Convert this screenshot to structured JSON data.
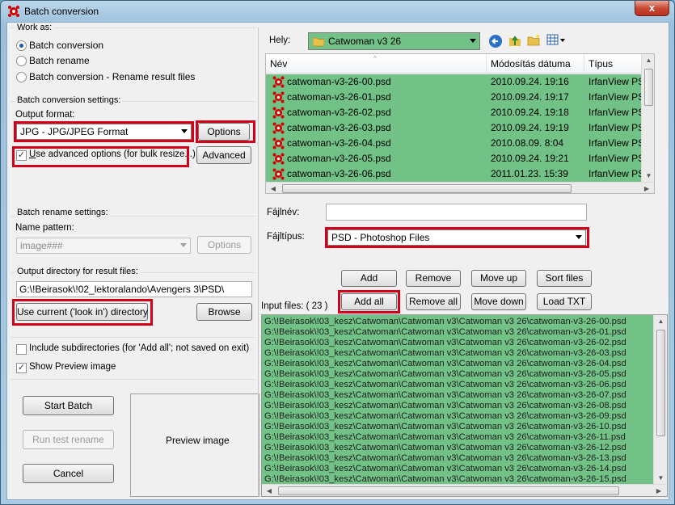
{
  "window": {
    "title": "Batch conversion",
    "close_glyph": "x"
  },
  "work_as": {
    "group_title": "Work as:",
    "options": [
      {
        "label": "Batch conversion",
        "checked": true
      },
      {
        "label": "Batch rename",
        "checked": false
      },
      {
        "label": "Batch conversion - Rename result files",
        "checked": false
      }
    ]
  },
  "conversion": {
    "group_title": "Batch conversion settings:",
    "output_format_label": "Output format:",
    "output_format_value": "JPG - JPG/JPEG Format",
    "options_button": "Options",
    "advanced_checkbox": "Use advanced options (for bulk resize...)",
    "advanced_checked": true,
    "advanced_button": "Advanced"
  },
  "rename": {
    "group_title": "Batch rename settings:",
    "name_pattern_label": "Name pattern:",
    "name_pattern_value": "image###",
    "options_button": "Options"
  },
  "output_dir": {
    "group_title": "Output directory for result files:",
    "path": "G:\\!Beirasok\\!02_lektoralando\\Avengers 3\\PSD\\",
    "use_current_button": "Use current ('look in') directory",
    "browse_button": "Browse"
  },
  "checks": {
    "include_subdirs": "Include subdirectories (for 'Add all'; not saved on exit)",
    "include_subdirs_checked": false,
    "show_preview": "Show Preview image",
    "show_preview_checked": true
  },
  "actions": {
    "start": "Start Batch",
    "run_test": "Run test rename",
    "cancel": "Cancel",
    "preview_label": "Preview image"
  },
  "browser": {
    "look_in_label": "Hely:",
    "look_in_value": "Catwoman v3 26",
    "columns": [
      "Név",
      "Módosítás dátuma",
      "Típus"
    ],
    "files": [
      {
        "name": "catwoman-v3-26-00.psd",
        "date": "2010.09.24. 19:16",
        "type": "IrfanView PSD F"
      },
      {
        "name": "catwoman-v3-26-01.psd",
        "date": "2010.09.24. 19:17",
        "type": "IrfanView PSD F"
      },
      {
        "name": "catwoman-v3-26-02.psd",
        "date": "2010.09.24. 19:18",
        "type": "IrfanView PSD F"
      },
      {
        "name": "catwoman-v3-26-03.psd",
        "date": "2010.09.24. 19:19",
        "type": "IrfanView PSD F"
      },
      {
        "name": "catwoman-v3-26-04.psd",
        "date": "2010.08.09. 8:04",
        "type": "IrfanView PSD F"
      },
      {
        "name": "catwoman-v3-26-05.psd",
        "date": "2010.09.24. 19:21",
        "type": "IrfanView PSD F"
      },
      {
        "name": "catwoman-v3-26-06.psd",
        "date": "2011.01.23. 15:39",
        "type": "IrfanView PSD F"
      }
    ],
    "filename_label": "Fájlnév:",
    "filename_value": "",
    "filetype_label": "Fájltípus:",
    "filetype_value": "PSD - Photoshop Files"
  },
  "list_buttons": {
    "add": "Add",
    "remove": "Remove",
    "move_up": "Move up",
    "sort_files": "Sort files",
    "add_all": "Add all",
    "remove_all": "Remove all",
    "move_down": "Move down",
    "load_txt": "Load TXT"
  },
  "input_files": {
    "label": "Input files: ( 23 )",
    "items": [
      "G:\\!Beirasok\\!03_kesz\\Catwoman\\Catwoman v3\\Catwoman v3 26\\catwoman-v3-26-00.psd",
      "G:\\!Beirasok\\!03_kesz\\Catwoman\\Catwoman v3\\Catwoman v3 26\\catwoman-v3-26-01.psd",
      "G:\\!Beirasok\\!03_kesz\\Catwoman\\Catwoman v3\\Catwoman v3 26\\catwoman-v3-26-02.psd",
      "G:\\!Beirasok\\!03_kesz\\Catwoman\\Catwoman v3\\Catwoman v3 26\\catwoman-v3-26-03.psd",
      "G:\\!Beirasok\\!03_kesz\\Catwoman\\Catwoman v3\\Catwoman v3 26\\catwoman-v3-26-04.psd",
      "G:\\!Beirasok\\!03_kesz\\Catwoman\\Catwoman v3\\Catwoman v3 26\\catwoman-v3-26-05.psd",
      "G:\\!Beirasok\\!03_kesz\\Catwoman\\Catwoman v3\\Catwoman v3 26\\catwoman-v3-26-06.psd",
      "G:\\!Beirasok\\!03_kesz\\Catwoman\\Catwoman v3\\Catwoman v3 26\\catwoman-v3-26-07.psd",
      "G:\\!Beirasok\\!03_kesz\\Catwoman\\Catwoman v3\\Catwoman v3 26\\catwoman-v3-26-08.psd",
      "G:\\!Beirasok\\!03_kesz\\Catwoman\\Catwoman v3\\Catwoman v3 26\\catwoman-v3-26-09.psd",
      "G:\\!Beirasok\\!03_kesz\\Catwoman\\Catwoman v3\\Catwoman v3 26\\catwoman-v3-26-10.psd",
      "G:\\!Beirasok\\!03_kesz\\Catwoman\\Catwoman v3\\Catwoman v3 26\\catwoman-v3-26-11.psd",
      "G:\\!Beirasok\\!03_kesz\\Catwoman\\Catwoman v3\\Catwoman v3 26\\catwoman-v3-26-12.psd",
      "G:\\!Beirasok\\!03_kesz\\Catwoman\\Catwoman v3\\Catwoman v3 26\\catwoman-v3-26-13.psd",
      "G:\\!Beirasok\\!03_kesz\\Catwoman\\Catwoman v3\\Catwoman v3 26\\catwoman-v3-26-14.psd",
      "G:\\!Beirasok\\!03_kesz\\Catwoman\\Catwoman v3\\Catwoman v3 26\\catwoman-v3-26-15.psd"
    ]
  },
  "colors": {
    "selection_green": "#72c187",
    "highlight_red": "#d4001a"
  }
}
